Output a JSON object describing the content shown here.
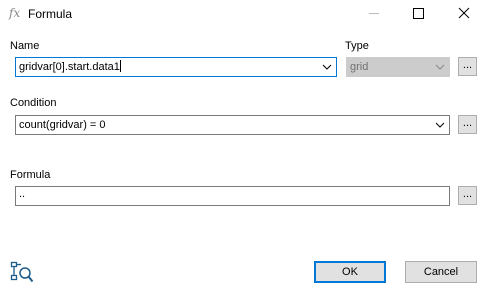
{
  "window": {
    "icon": "fx-icon",
    "icon_glyph": "fx",
    "title": "Formula"
  },
  "name_section": {
    "label": "Name",
    "value": "gridvar[0].start.data1"
  },
  "type_section": {
    "label": "Type",
    "value": "grid"
  },
  "condition_section": {
    "label": "Condition",
    "value": "count(gridvar) = 0"
  },
  "formula_section": {
    "label": "Formula",
    "value": ".."
  },
  "buttons": {
    "browse_label": "...",
    "ok_label": "OK",
    "cancel_label": "Cancel"
  },
  "colors": {
    "accent": "#0078d7",
    "button_face": "#e1e1e1",
    "disabled_face": "#cccccc"
  }
}
